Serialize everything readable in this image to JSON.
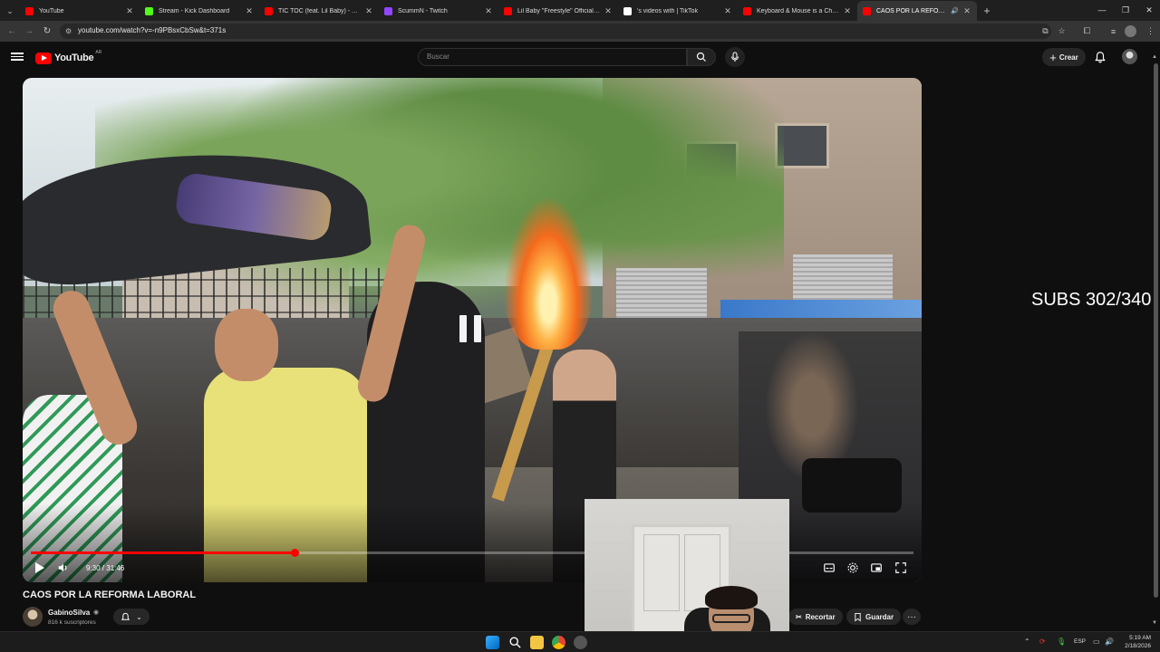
{
  "browser": {
    "tabs": [
      {
        "title": "YouTube",
        "favicon_color": "#ff0000"
      },
      {
        "title": "Stream - Kick Dashboard",
        "favicon_color": "#53fc18"
      },
      {
        "title": "TIC TOC (feat. Lil Baby) - YouTube",
        "favicon_color": "#ff0000"
      },
      {
        "title": "ScummN - Twitch",
        "favicon_color": "#9146ff"
      },
      {
        "title": "Lil Baby \"Freestyle\" Official Music",
        "favicon_color": "#ff0000"
      },
      {
        "title": "'s videos with | TikTok",
        "favicon_color": "#ffffff"
      },
      {
        "title": "Keyboard & Mouse is a Cheat Co",
        "favicon_color": "#ff0000"
      },
      {
        "title": "CAOS POR LA REFORMA LA",
        "favicon_color": "#ff0000",
        "active": true
      }
    ],
    "url": "youtube.com/watch?v=-n9PBsxCbSw&t=371s"
  },
  "youtube": {
    "logo_text": "YouTube",
    "country_code": "AR",
    "search_placeholder": "Buscar",
    "create_label": "Crear"
  },
  "player": {
    "current_time": "9:30",
    "duration": "31:46",
    "time_display": "9:30 / 31:46",
    "progress_fraction": 0.299,
    "state": "paused-overlay"
  },
  "overlay": {
    "subs_text": "SUBS 302/340"
  },
  "video": {
    "title": "CAOS POR LA REFORMA LABORAL",
    "channel_name": "GabinoSilva",
    "subscribers": "816 k suscriptores",
    "clip_label": "Recortar",
    "save_label": "Guardar",
    "more_label": "···"
  },
  "taskbar": {
    "lang": "ESP",
    "time": "5:19 AM",
    "date": "2/18/2026"
  }
}
